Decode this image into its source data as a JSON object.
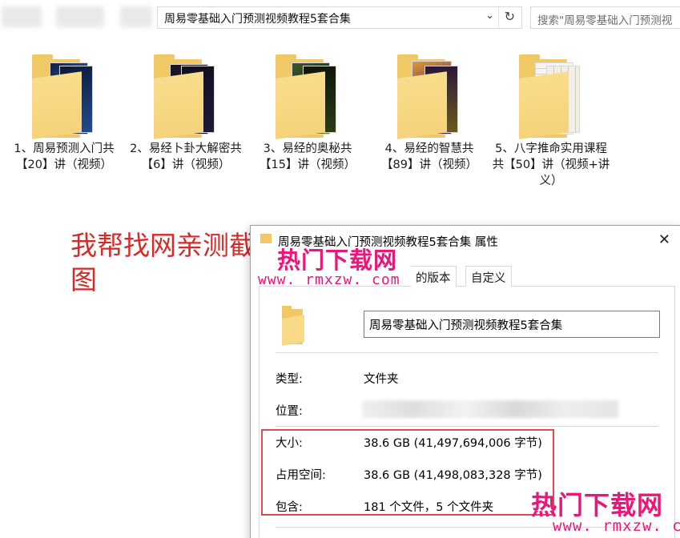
{
  "address_bar": {
    "path": "周易零基础入门预测视频教程5套合集",
    "search_placeholder": "搜索\"周易零基础入门预测视"
  },
  "folders": [
    {
      "label": "1、周易预测入门共【20】讲（视频）",
      "thumb_color": "#1d3a72"
    },
    {
      "label": "2、易经卜卦大解密共【6】讲（视频）",
      "thumb_color": "#1b1730"
    },
    {
      "label": "3、易经的奥秘共【15】讲（视频）",
      "thumb_color": "#203322"
    },
    {
      "label": "4、易经的智慧共【89】讲（视频）",
      "thumb_color": "#5a2b3e"
    },
    {
      "label": "5、八字推命实用课程共【50】讲（视频+讲义）",
      "thumb_color": "#f4f1ea"
    }
  ],
  "note": {
    "text": "我帮找网亲测截图"
  },
  "dialog": {
    "title": "周易零基础入门预测视频教程5套合集 属性",
    "tabs": [
      "的版本",
      "自定义"
    ],
    "name_value": "周易零基础入门预测视频教程5套合集",
    "properties": [
      {
        "label": "类型:",
        "value": "文件夹"
      },
      {
        "label": "位置:",
        "value": ""
      },
      {
        "label": "大小:",
        "value": "38.6 GB (41,497,694,006 字节)"
      },
      {
        "label": "占用空间:",
        "value": "38.6 GB (41,498,083,328 字节)"
      },
      {
        "label": "包含:",
        "value": "181 个文件，5 个文件夹"
      }
    ]
  },
  "watermark": {
    "title": "热门下载网",
    "url": "www. rmxzw. com",
    "url_bottom": "www. rmxzw. com"
  },
  "colors": {
    "folder": "#f0c865",
    "note_red": "#d42a2a",
    "highlight_red": "#e14b4b",
    "watermark": "#e6197a"
  }
}
